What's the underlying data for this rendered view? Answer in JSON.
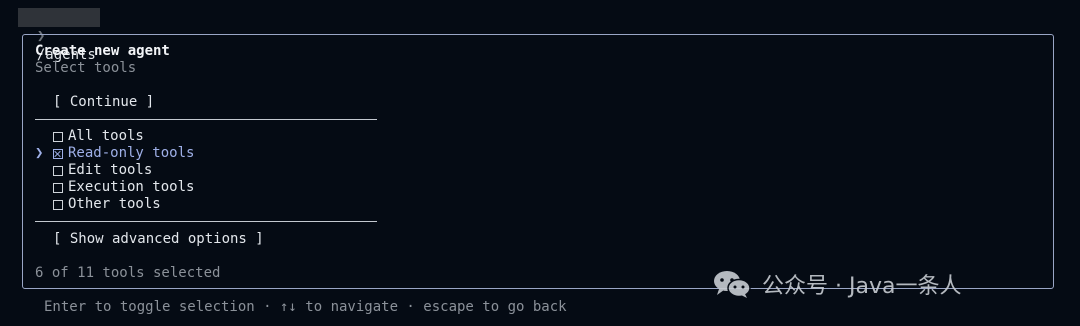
{
  "prompt": {
    "chevron": "❯",
    "command": "/agents"
  },
  "panel": {
    "title": "Create new agent",
    "subtitle": "Select tools",
    "continue_label": "[ Continue ]",
    "tools": [
      {
        "label": "All tools",
        "checked": false,
        "active": false
      },
      {
        "label": "Read-only tools",
        "checked": true,
        "active": true
      },
      {
        "label": "Edit tools",
        "checked": false,
        "active": false
      },
      {
        "label": "Execution tools",
        "checked": false,
        "active": false
      },
      {
        "label": "Other tools",
        "checked": false,
        "active": false
      }
    ],
    "cursor_glyph": "❯",
    "advanced_label": "[ Show advanced options ]",
    "status": "6 of 11 tools selected"
  },
  "footer_hint": "Enter to toggle selection · ↑↓ to navigate · escape to go back",
  "watermark": {
    "text": "公众号 · Java一条人",
    "icon": "wechat-icon"
  },
  "colors": {
    "background": "#050b14",
    "border": "#9aa6c6",
    "accent": "#9fb0e8",
    "muted": "#8b9199"
  }
}
